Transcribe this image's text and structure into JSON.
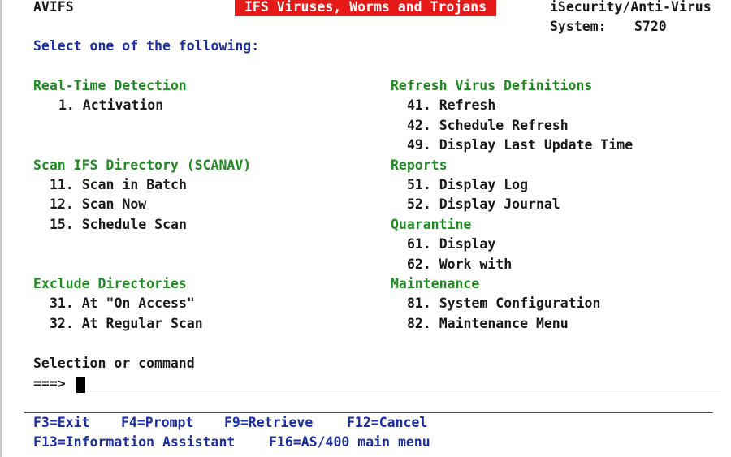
{
  "header": {
    "program": "AVIFS",
    "title": "IFS Viruses, Worms and Trojans",
    "product": "iSecurity/Anti-Virus",
    "system_label": "System:",
    "system_value": "S720"
  },
  "prompt": "Select one of the following:",
  "left": {
    "realtime": {
      "heading": "Real-Time Detection",
      "items": [
        "1. Activation"
      ]
    },
    "scan": {
      "heading": "Scan IFS Directory (SCANAV)",
      "items": [
        "11. Scan in Batch",
        "12. Scan Now",
        "15. Schedule Scan"
      ]
    },
    "exclude": {
      "heading": "Exclude Directories",
      "items": [
        "31. At \"On Access\"",
        "32. At Regular Scan"
      ]
    }
  },
  "right": {
    "refresh": {
      "heading": "Refresh Virus Definitions",
      "items": [
        "41. Refresh",
        "42. Schedule Refresh",
        "49. Display Last Update Time"
      ]
    },
    "reports": {
      "heading": "Reports",
      "items": [
        "51. Display Log",
        "52. Display Journal"
      ]
    },
    "quarantine": {
      "heading": "Quarantine",
      "items": [
        "61. Display",
        "62. Work with"
      ]
    },
    "maintenance": {
      "heading": "Maintenance",
      "items": [
        "81. System Configuration",
        "82. Maintenance Menu"
      ]
    }
  },
  "command": {
    "label": "Selection or command",
    "arrow": "===>"
  },
  "fkeys": {
    "f3": "F3=Exit",
    "f4": "F4=Prompt",
    "f9": "F9=Retrieve",
    "f12": "F12=Cancel",
    "f13": "F13=Information Assistant",
    "f16": "F16=AS/400 main menu"
  },
  "colors": {
    "banner": "#e61919",
    "heading": "#1f8a1f",
    "blue": "#1c2fa0",
    "text": "#1a1a1a"
  }
}
